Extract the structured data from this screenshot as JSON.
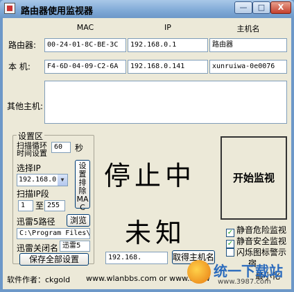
{
  "window": {
    "title": "路由器使用监视器",
    "min_glyph": "—",
    "max_glyph": "□",
    "close_glyph": "X"
  },
  "columns": {
    "mac": "MAC",
    "ip": "IP",
    "host": "主机名"
  },
  "router": {
    "label": "路由器:",
    "mac": "00-24-01-8C-BE-3C",
    "ip": "192.168.0.1",
    "host": "路由器"
  },
  "local": {
    "label": "本  机:",
    "mac": "F4-6D-04-09-C2-6A",
    "ip": "192.168.0.141",
    "host": "xunruiwa-0e0076"
  },
  "others": {
    "label": "其他主机:"
  },
  "settings": {
    "title": "设置区",
    "scan_cycle_label_1": "扫描循环",
    "scan_cycle_label_2": "时间设置",
    "scan_cycle_value": "60",
    "scan_cycle_unit": "秒",
    "select_ip_label": "选择IP",
    "select_ip_value": "192.168.0.",
    "set_exclude_button": "设置排除MAC",
    "scan_range_label": "扫描IP段",
    "range_from": "1",
    "range_to_label": "至",
    "range_to": "255",
    "thunder_path_label": "迅雷5路径",
    "browse_button": "浏览",
    "thunder_path_value": "C:\\Program Files\\T",
    "thunder_close_label": "迅雷关闭名",
    "thunder_close_value": "迅雷5",
    "save_all_button": "保存全部设置"
  },
  "status": {
    "line1": "停止中",
    "line2": "未知"
  },
  "start_button": "开始监视",
  "options": {
    "mute_danger": "静音危险监视",
    "mute_safe": "静音安全监视",
    "blink_icon": "闪烁图标警示",
    "tray_partial": "宿",
    "minimize_partial": "最小化"
  },
  "bottom": {
    "ip_input": "192.168.",
    "fetch_button": "取得主机名"
  },
  "footer": {
    "author": "软件作者：ckgold",
    "sites": "www.wlanbbs.com or www.anyw"
  },
  "watermark": {
    "brand": "统一下载站",
    "url": "www.3987.com"
  }
}
